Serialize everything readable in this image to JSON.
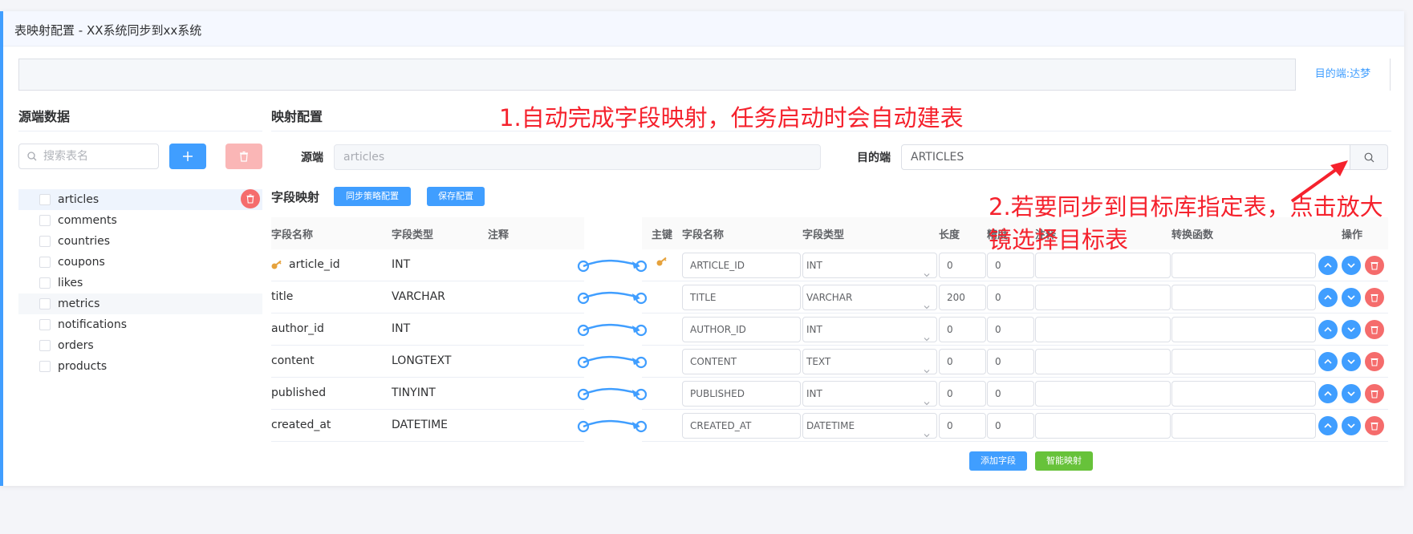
{
  "page": {
    "title": "表映射配置 - XX系统同步到xx系统",
    "tab_target": "目的端:达梦"
  },
  "source_panel": {
    "title": "源端数据",
    "search_placeholder": "搜索表名",
    "add_button": "+",
    "tables": [
      "articles",
      "comments",
      "countries",
      "coupons",
      "likes",
      "metrics",
      "notifications",
      "orders",
      "products"
    ],
    "selected": "articles"
  },
  "mapping": {
    "title": "映射配置",
    "source_label": "源端",
    "source_value": "articles",
    "target_label": "目的端",
    "target_value": "ARTICLES",
    "field_mapping_title": "字段映射",
    "sync_strategy_button": "同步策略配置",
    "save_button": "保存配置",
    "add_field_button": "添加字段",
    "smart_map_button": "智能映射"
  },
  "source_columns": {
    "headers": [
      "字段名称",
      "字段类型",
      "注释"
    ],
    "rows": [
      {
        "name": "article_id",
        "type": "INT",
        "pk": true
      },
      {
        "name": "title",
        "type": "VARCHAR",
        "pk": false
      },
      {
        "name": "author_id",
        "type": "INT",
        "pk": false
      },
      {
        "name": "content",
        "type": "LONGTEXT",
        "pk": false
      },
      {
        "name": "published",
        "type": "TINYINT",
        "pk": false
      },
      {
        "name": "created_at",
        "type": "DATETIME",
        "pk": false
      }
    ]
  },
  "target_columns": {
    "headers": [
      "主键",
      "字段名称",
      "字段类型",
      "长度",
      "精度",
      "注释",
      "转换函数",
      "操作"
    ],
    "rows": [
      {
        "pk": true,
        "name": "ARTICLE_ID",
        "type": "INT",
        "length": "0",
        "precision": "0"
      },
      {
        "pk": false,
        "name": "TITLE",
        "type": "VARCHAR",
        "length": "200",
        "precision": "0"
      },
      {
        "pk": false,
        "name": "AUTHOR_ID",
        "type": "INT",
        "length": "0",
        "precision": "0"
      },
      {
        "pk": false,
        "name": "CONTENT",
        "type": "TEXT",
        "length": "0",
        "precision": "0"
      },
      {
        "pk": false,
        "name": "PUBLISHED",
        "type": "INT",
        "length": "0",
        "precision": "0"
      },
      {
        "pk": false,
        "name": "CREATED_AT",
        "type": "DATETIME",
        "length": "0",
        "precision": "0"
      }
    ]
  },
  "annotations": {
    "note1": "1.自动完成字段映射，任务启动时会自动建表",
    "note2_line1": "2.若要同步到目标库指定表，点击放大",
    "note2_line2": "镜选择目标表"
  },
  "colors": {
    "primary": "#409eff",
    "danger": "#f56c6c",
    "success": "#67c23a",
    "annotation": "#f5222d",
    "key": "#e6a23c"
  },
  "icons": {
    "search": "search-icon",
    "trash": "trash-icon",
    "up": "arrow-up-icon",
    "down": "arrow-down-icon",
    "key": "key-icon",
    "link": "mapping-link-icon"
  }
}
